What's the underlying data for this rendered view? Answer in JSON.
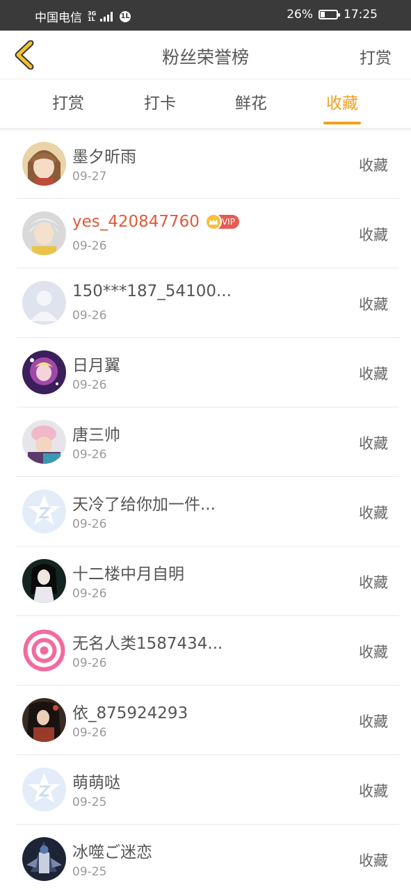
{
  "status_bar": {
    "carrier": "中国电信",
    "network_top": "3G",
    "network_bottom": "1L",
    "hd_badge": "1L",
    "battery_percent": "26%",
    "battery_level": 0.26,
    "time": "17:25"
  },
  "header": {
    "back_icon": "chevron-left-icon",
    "title": "粉丝荣誉榜",
    "right_action": "打赏"
  },
  "tabs": [
    {
      "label": "打赏",
      "active": false
    },
    {
      "label": "打卡",
      "active": false
    },
    {
      "label": "鲜花",
      "active": false
    },
    {
      "label": "收藏",
      "active": true
    }
  ],
  "colors": {
    "accent": "#f0a020",
    "vip_name": "#e05a3a",
    "status_bar_bg": "#3a3a3a"
  },
  "fans": [
    {
      "name": "墨夕昕雨",
      "date": "09-27",
      "action": "收藏",
      "vip": false
    },
    {
      "name": "yes_420847760",
      "date": "09-26",
      "action": "收藏",
      "vip": true,
      "vip_label": "VIP"
    },
    {
      "name": "150***187_54100...",
      "date": "09-26",
      "action": "收藏",
      "vip": false
    },
    {
      "name": "日月翼",
      "date": "09-26",
      "action": "收藏",
      "vip": false
    },
    {
      "name": "唐三帅",
      "date": "09-26",
      "action": "收藏",
      "vip": false
    },
    {
      "name": "天冷了给你加一件...",
      "date": "09-26",
      "action": "收藏",
      "vip": false
    },
    {
      "name": "十二楼中月自明",
      "date": "09-26",
      "action": "收藏",
      "vip": false
    },
    {
      "name": "无名人类1587434...",
      "date": "09-26",
      "action": "收藏",
      "vip": false
    },
    {
      "name": "依_875924293",
      "date": "09-26",
      "action": "收藏",
      "vip": false
    },
    {
      "name": "萌萌哒",
      "date": "09-25",
      "action": "收藏",
      "vip": false
    },
    {
      "name": "冰噬ご迷恋",
      "date": "09-25",
      "action": "收藏",
      "vip": false
    }
  ]
}
